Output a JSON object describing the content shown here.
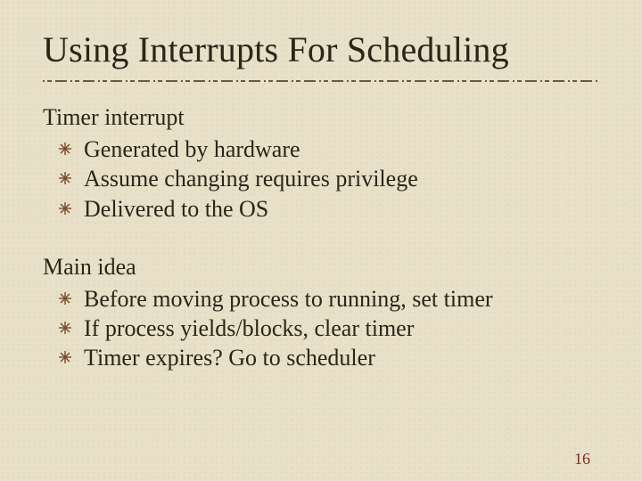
{
  "title": "Using Interrupts For Scheduling",
  "section1": {
    "head": "Timer interrupt",
    "items": [
      "Generated by hardware",
      "Assume changing requires privilege",
      "Delivered to the OS"
    ]
  },
  "section2": {
    "head": "Main idea",
    "items": [
      "Before moving process to running, set timer",
      "If process yields/blocks, clear timer",
      "Timer expires? Go to scheduler"
    ]
  },
  "page_number": "16",
  "colors": {
    "bullet": "#7a4a2a",
    "pagenum": "#7a2d1e"
  }
}
